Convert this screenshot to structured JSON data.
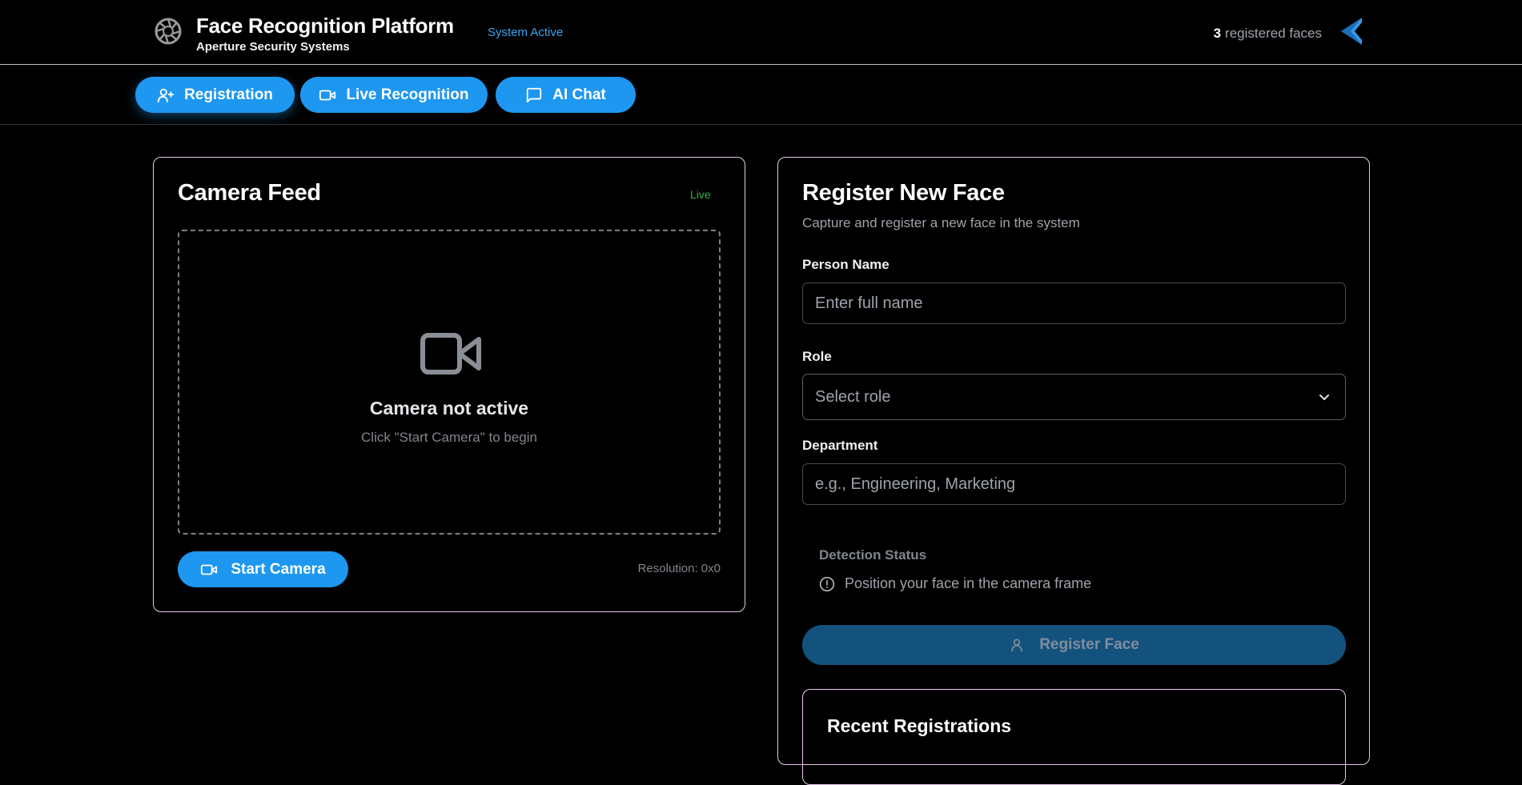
{
  "header": {
    "title": "Face Recognition Platform",
    "subtitle": "Aperture Security Systems",
    "system_status": "System Active",
    "registered_count": "3",
    "registered_label": "registered faces"
  },
  "tabs": [
    {
      "label": "Registration",
      "icon": "user-plus-icon",
      "active": true
    },
    {
      "label": "Live Recognition",
      "icon": "video-icon",
      "active": false
    },
    {
      "label": "AI Chat",
      "icon": "message-icon",
      "active": false
    }
  ],
  "camera": {
    "title": "Camera Feed",
    "live_label": "Live",
    "empty_title": "Camera not active",
    "empty_hint": "Click \"Start Camera\" to begin",
    "start_button": "Start Camera",
    "resolution": "Resolution: 0x0"
  },
  "register": {
    "title": "Register New Face",
    "subtitle": "Capture and register a new face in the system",
    "name_label": "Person Name",
    "name_placeholder": "Enter full name",
    "role_label": "Role",
    "role_selected": "Select role",
    "department_label": "Department",
    "department_placeholder": "e.g., Engineering, Marketing",
    "detection_title": "Detection Status",
    "detection_message": "Position your face in the camera frame",
    "register_button": "Register Face",
    "recent_title": "Recent Registrations"
  },
  "colors": {
    "accent": "#1d97f0",
    "live": "#2fb34a",
    "card_border": "#e8c9ec",
    "disabled_button": "#13527d"
  }
}
